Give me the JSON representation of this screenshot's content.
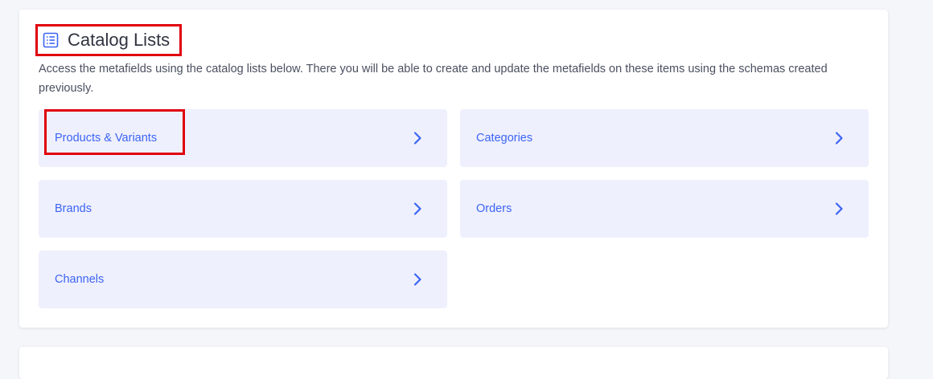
{
  "catalog": {
    "title": "Catalog Lists",
    "title_icon": "list-icon",
    "description": "Access the metafields using the catalog lists below. There you will be able to create and update the metafields on these items using the schemas created previously.",
    "items": [
      {
        "label": "Products & Variants",
        "icon": "chevron-right-icon"
      },
      {
        "label": "Categories",
        "icon": "chevron-right-icon"
      },
      {
        "label": "Brands",
        "icon": "chevron-right-icon"
      },
      {
        "label": "Orders",
        "icon": "chevron-right-icon"
      },
      {
        "label": "Channels",
        "icon": "chevron-right-icon"
      }
    ]
  },
  "colors": {
    "accent": "#3c64f4",
    "tile_background": "#eff0fd",
    "highlight": "#e0000d"
  }
}
